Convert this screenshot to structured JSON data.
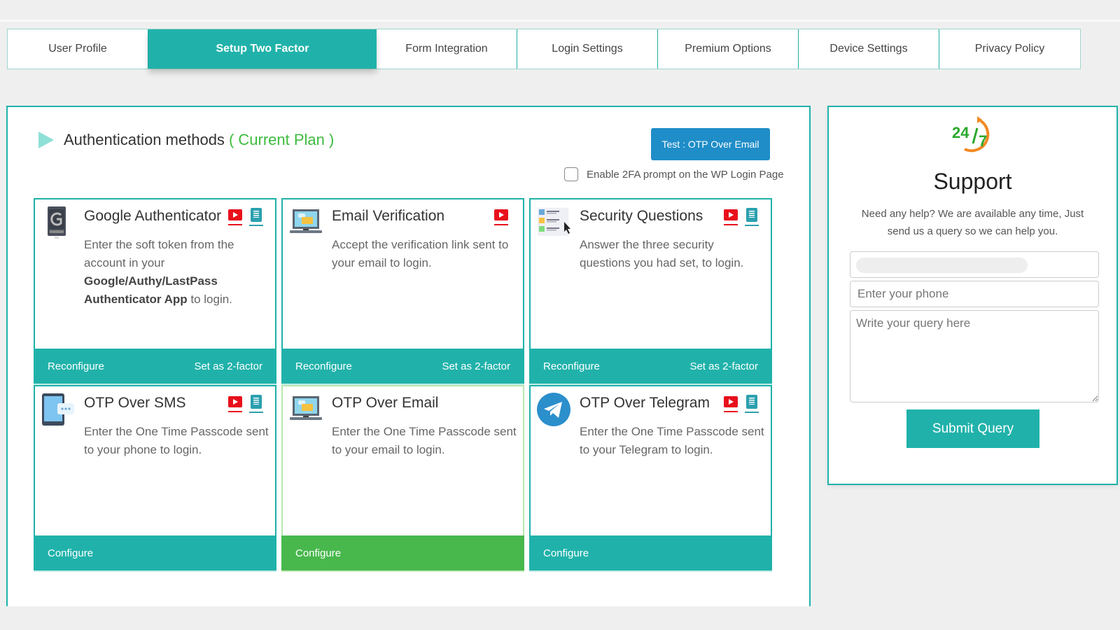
{
  "tabs": [
    {
      "label": "User Profile",
      "active": false
    },
    {
      "label": "Setup Two Factor",
      "active": true
    },
    {
      "label": "Form Integration",
      "active": false
    },
    {
      "label": "Login Settings",
      "active": false
    },
    {
      "label": "Premium Options",
      "active": false
    },
    {
      "label": "Device Settings",
      "active": false
    },
    {
      "label": "Privacy Policy",
      "active": false
    }
  ],
  "main": {
    "section_title": "Authentication methods",
    "plan_label": "( Current Plan )",
    "test_button": "Test : OTP Over Email",
    "enable_prompt_label": "Enable 2FA prompt on the WP Login Page",
    "enable_prompt_checked": false,
    "methods": [
      {
        "title": "Google Authenticator",
        "desc_parts": [
          "Enter the soft token from the account in your ",
          "Google/Authy/LastPass Authenticator App",
          " to login."
        ],
        "icon": "google-authenticator-icon",
        "has_video": true,
        "has_doc": true,
        "footer_left": "Reconfigure",
        "footer_right": "Set as 2-factor",
        "active": false
      },
      {
        "title": "Email Verification",
        "desc": "Accept the verification link sent to your email to login.",
        "icon": "laptop-email-icon",
        "has_video": true,
        "has_doc": false,
        "footer_left": "Reconfigure",
        "footer_right": "Set as 2-factor",
        "active": false
      },
      {
        "title": "Security Questions",
        "desc": "Answer the three security questions you had set, to login.",
        "icon": "security-questions-icon",
        "has_video": true,
        "has_doc": true,
        "footer_left": "Reconfigure",
        "footer_right": "Set as 2-factor",
        "active": false
      },
      {
        "title": "OTP Over SMS",
        "desc": "Enter the One Time Passcode sent to your phone to login.",
        "icon": "phone-sms-icon",
        "has_video": true,
        "has_doc": true,
        "footer_left": "Configure",
        "footer_right": "",
        "active": false
      },
      {
        "title": "OTP Over Email",
        "desc": "Enter the One Time Passcode sent to your email to login.",
        "icon": "laptop-email-icon",
        "has_video": false,
        "has_doc": false,
        "footer_left": "Configure",
        "footer_right": "",
        "active": true
      },
      {
        "title": "OTP Over Telegram",
        "desc": "Enter the One Time Passcode sent to your Telegram to login.",
        "icon": "telegram-icon",
        "has_video": true,
        "has_doc": true,
        "footer_left": "Configure",
        "footer_right": "",
        "active": false
      }
    ]
  },
  "support": {
    "logo_text": "24/7",
    "title": "Support",
    "lead": "Need any help? We are available any time, Just send us a query so we can help you.",
    "email_value": "",
    "phone_placeholder": "Enter your phone",
    "query_placeholder": "Write your query here",
    "submit_label": "Submit Query"
  },
  "colors": {
    "accent": "#20b2aa",
    "active_green": "#48b84d",
    "test_button_blue": "#1f8dc8",
    "plan_green": "#3dbb3d",
    "video_red": "#e8101c",
    "doc_teal": "#2aa0ae"
  }
}
